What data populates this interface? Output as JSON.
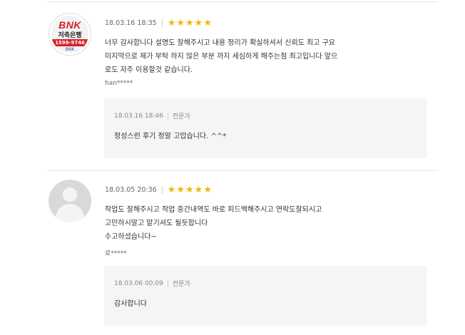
{
  "reviews": [
    {
      "avatar": {
        "type": "bnk-logo",
        "logo": "BNK",
        "name": "저축은행",
        "phone": "1599-9746",
        "foot": "BNK"
      },
      "date": "18.03.16 18:35",
      "rating": 5,
      "text_lines": [
        "너무 감사합니다 설명도 잘해주시고 내용 정리가 확실하셔서 신뢰도 최고 구요",
        "미지막으로 제가 부탁 하지 않은 부분 까지 세심하게 해주는점 최고입니다 앞으",
        "로도 자주 이용할것 같습니다."
      ],
      "author": "han*****",
      "reply": {
        "date": "18.03.16 18:46",
        "role": "전문가",
        "text": "정성스런 후기 정말 고맙습니다. ^^*"
      }
    },
    {
      "avatar": {
        "type": "default"
      },
      "date": "18.03.05 20:36",
      "rating": 5,
      "text_lines": [
        "작업도 잘해주시고 작업 중간내역도 바로 피드백해주시고 연락도잘되시고",
        "고민하시말고 맡기셔도 될듯합니다",
        "수고하셨습니다~"
      ],
      "author": "로*****",
      "reply": {
        "date": "18.03.06 00:09",
        "role": "전문가",
        "text": "감사합니다"
      }
    }
  ],
  "star_glyph": "★",
  "colors": {
    "star": "#f2b600",
    "brand_red": "#d4202a",
    "reply_bg": "#f5f5f5"
  }
}
